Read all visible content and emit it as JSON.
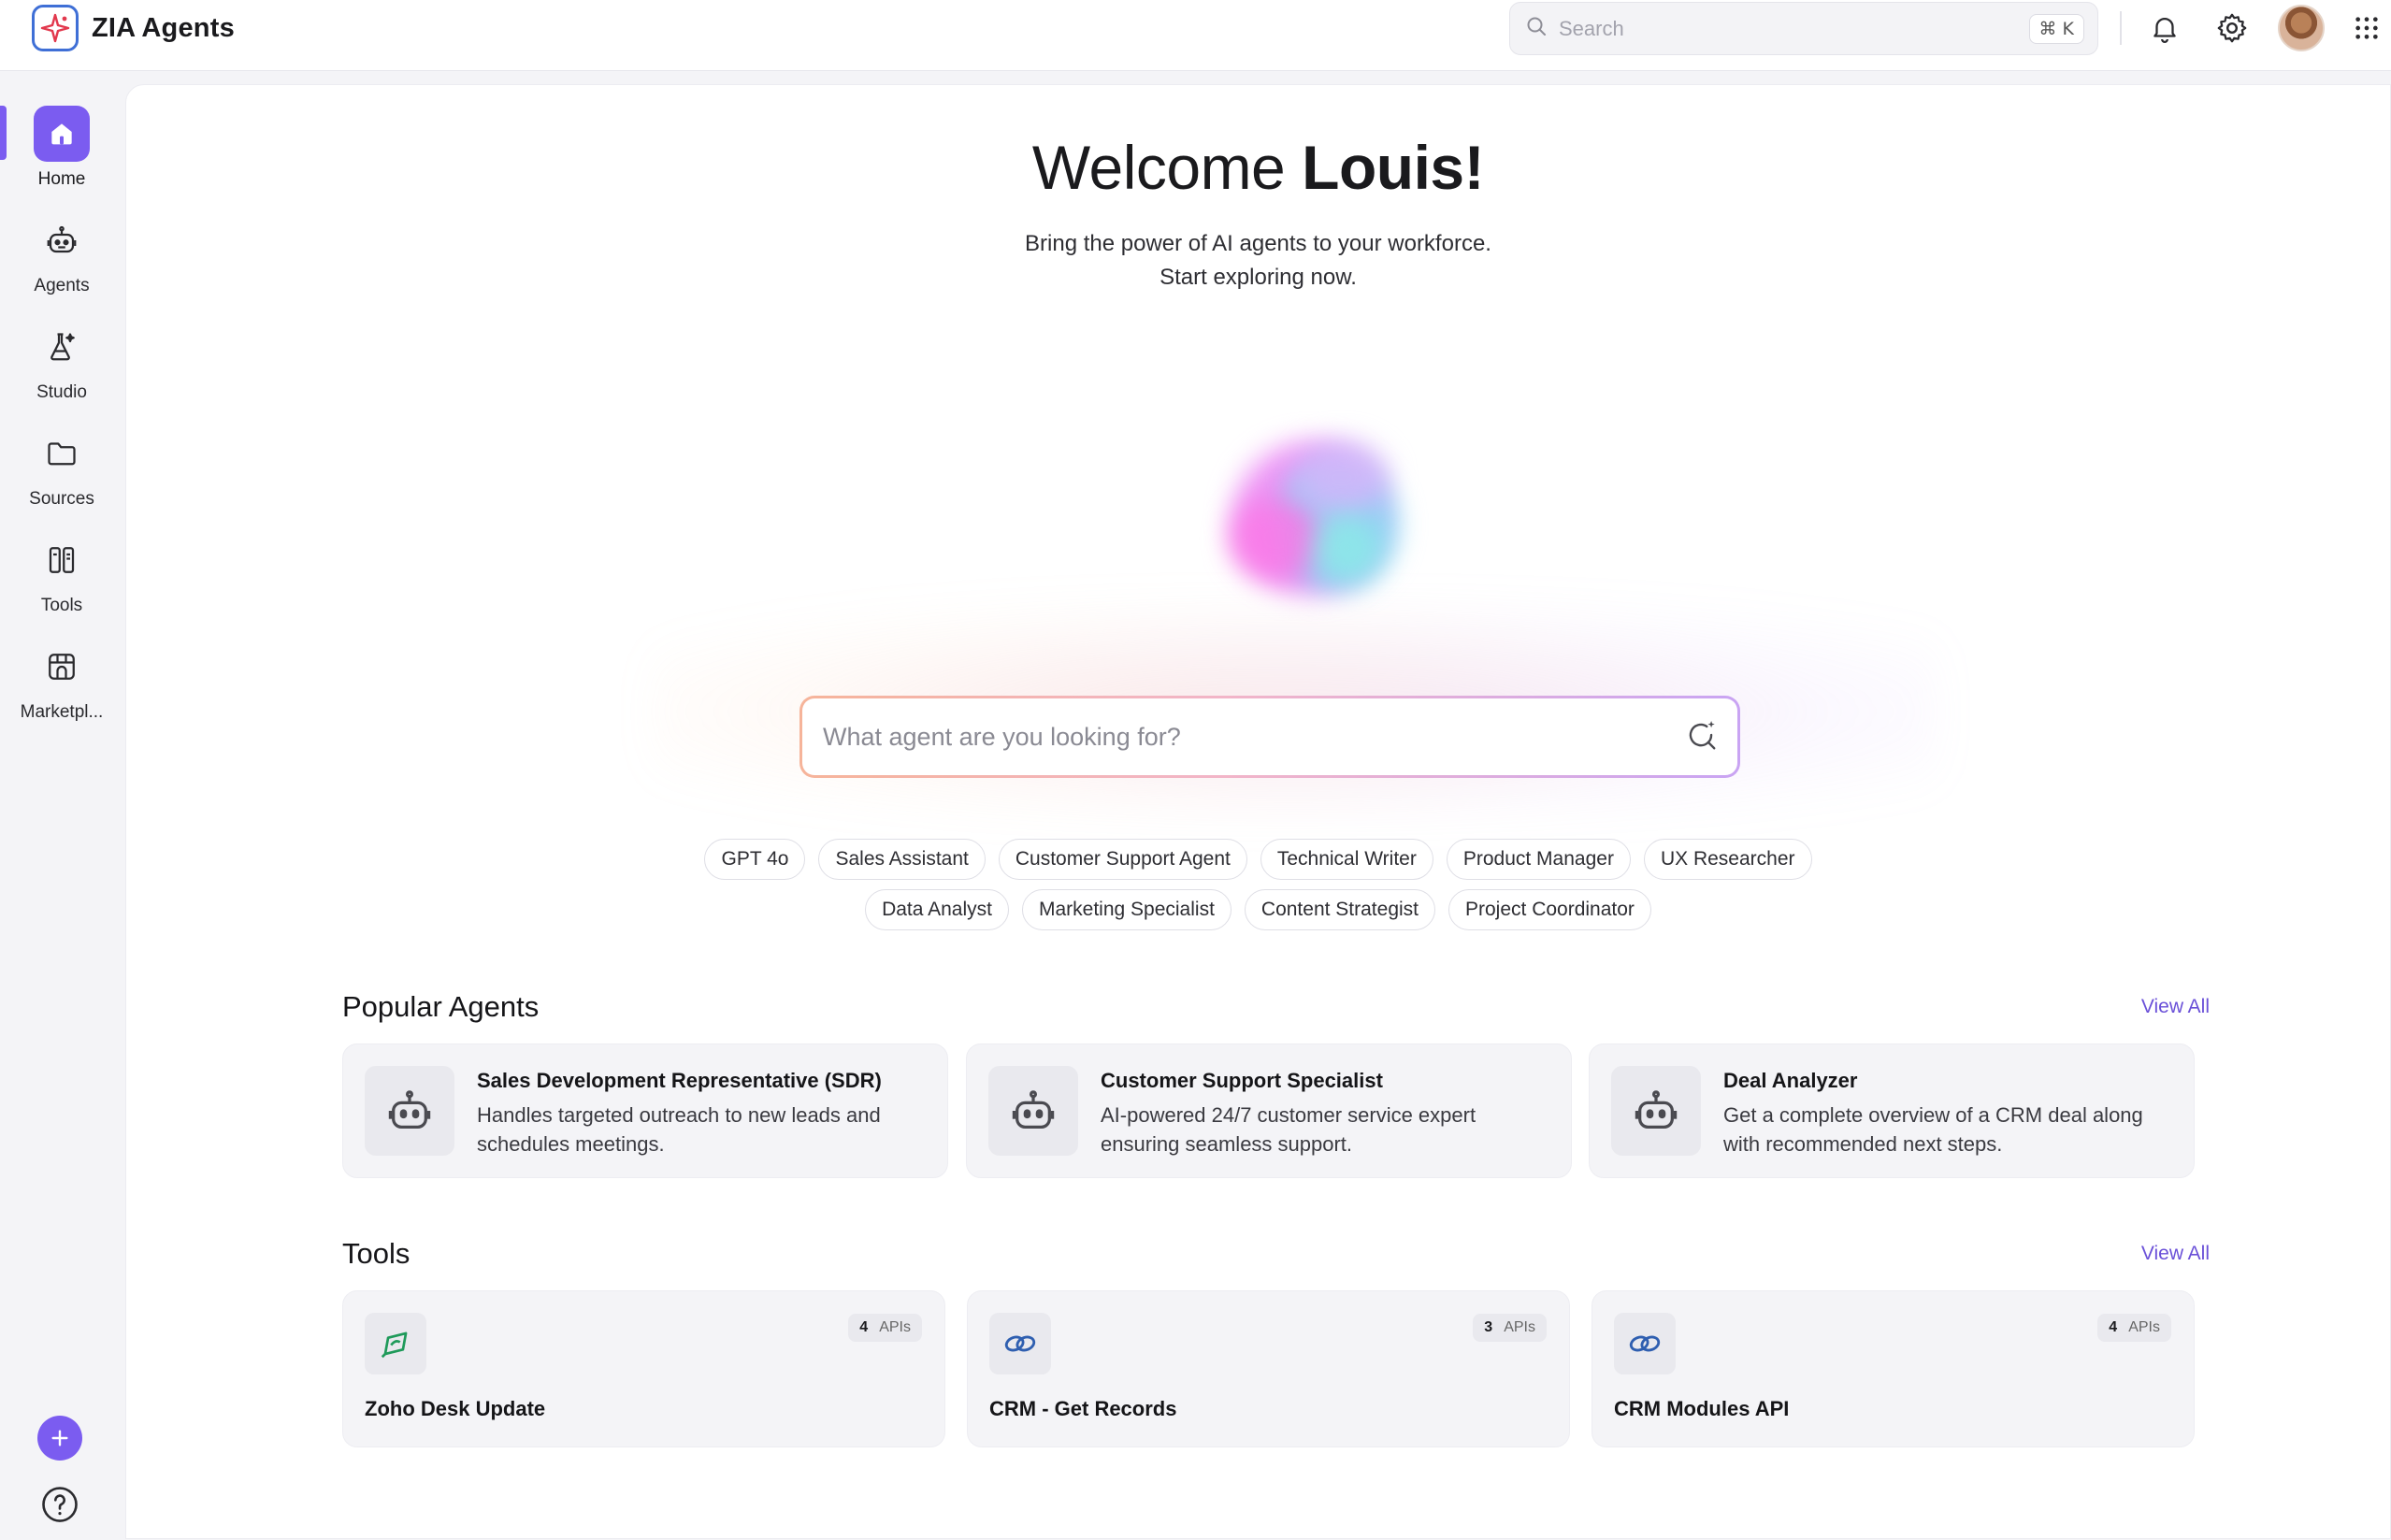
{
  "app": {
    "name": "ZIA Agents"
  },
  "header": {
    "search_placeholder": "Search",
    "search_shortcut": "⌘ K",
    "icons": [
      "bell-icon",
      "gear-icon",
      "user-avatar",
      "apps-grid-icon"
    ]
  },
  "sidebar": {
    "items": [
      {
        "label": "Home",
        "icon": "home-icon",
        "active": true
      },
      {
        "label": "Agents",
        "icon": "robot-icon",
        "active": false
      },
      {
        "label": "Studio",
        "icon": "flask-icon",
        "active": false
      },
      {
        "label": "Sources",
        "icon": "folder-icon",
        "active": false
      },
      {
        "label": "Tools",
        "icon": "tools-icon",
        "active": false
      },
      {
        "label": "Marketpl...",
        "icon": "store-icon",
        "active": false
      }
    ],
    "bottom": [
      "add-icon",
      "help-icon"
    ]
  },
  "hero": {
    "greeting": "Welcome",
    "user": "Louis!",
    "line1": "Bring the power of AI agents to your workforce.",
    "line2": "Start exploring now.",
    "search_placeholder": "What agent are you looking for?"
  },
  "chips": {
    "row1": [
      "GPT 4o",
      "Sales Assistant",
      "Customer Support Agent",
      "Technical Writer",
      "Product Manager",
      "UX Researcher"
    ],
    "row2": [
      "Data Analyst",
      "Marketing Specialist",
      "Content Strategist",
      "Project Coordinator"
    ]
  },
  "popular_agents": {
    "title": "Popular Agents",
    "view_all": "View All",
    "items": [
      {
        "title": "Sales Development Representative (SDR)",
        "desc": "Handles targeted outreach to new leads and schedules meetings."
      },
      {
        "title": "Customer Support Specialist",
        "desc": "AI-powered 24/7 customer service expert ensuring seamless support."
      },
      {
        "title": "Deal Analyzer",
        "desc": "Get a complete overview of a CRM deal along with recommended next steps."
      }
    ]
  },
  "tools": {
    "title": "Tools",
    "view_all": "View All",
    "api_label": "APIs",
    "items": [
      {
        "name": "Zoho Desk Update",
        "apis": "4",
        "icon": "zoho-desk-icon"
      },
      {
        "name": "CRM - Get Records",
        "apis": "3",
        "icon": "crm-link-icon"
      },
      {
        "name": "CRM Modules API",
        "apis": "4",
        "icon": "crm-link-icon"
      }
    ]
  },
  "colors": {
    "accent": "#7b5cf0",
    "link": "#6a50d8",
    "desk_green": "#1f9a5a",
    "crm_blue": "#2f5fb0"
  }
}
